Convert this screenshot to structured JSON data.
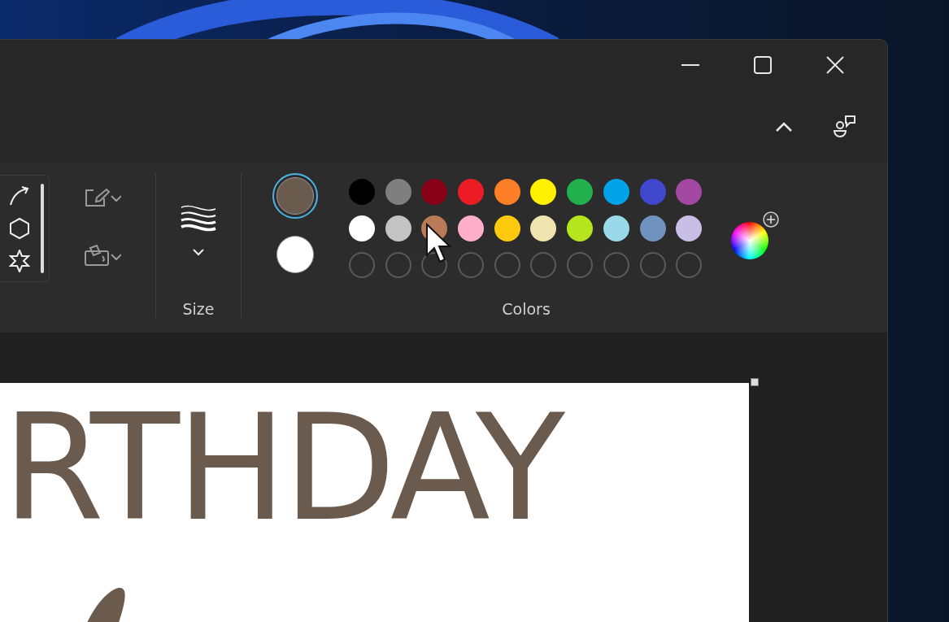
{
  "ribbon": {
    "size_group": {
      "label": "Size"
    },
    "colors_group": {
      "label": "Colors",
      "primary": {
        "color": "#6b5a4e",
        "selected": true
      },
      "secondary": {
        "color": "#ffffff",
        "selected": false
      },
      "palette": [
        [
          {
            "color": "#000000"
          },
          {
            "color": "#7f7f7f"
          },
          {
            "color": "#880015"
          },
          {
            "color": "#ed1c24"
          },
          {
            "color": "#ff7f27"
          },
          {
            "color": "#fff200"
          },
          {
            "color": "#22b14c"
          },
          {
            "color": "#00a2e8"
          },
          {
            "color": "#3f48cc"
          },
          {
            "color": "#a349a4"
          }
        ],
        [
          {
            "color": "#ffffff"
          },
          {
            "color": "#c3c3c3"
          },
          {
            "color": "#b97a57"
          },
          {
            "color": "#ffaec9"
          },
          {
            "color": "#ffc90e"
          },
          {
            "color": "#efe4b0"
          },
          {
            "color": "#b5e61d"
          },
          {
            "color": "#99d9ea"
          },
          {
            "color": "#7092be"
          },
          {
            "color": "#c8bfe7"
          }
        ]
      ]
    }
  },
  "canvas": {
    "text": "RTHDAY"
  }
}
